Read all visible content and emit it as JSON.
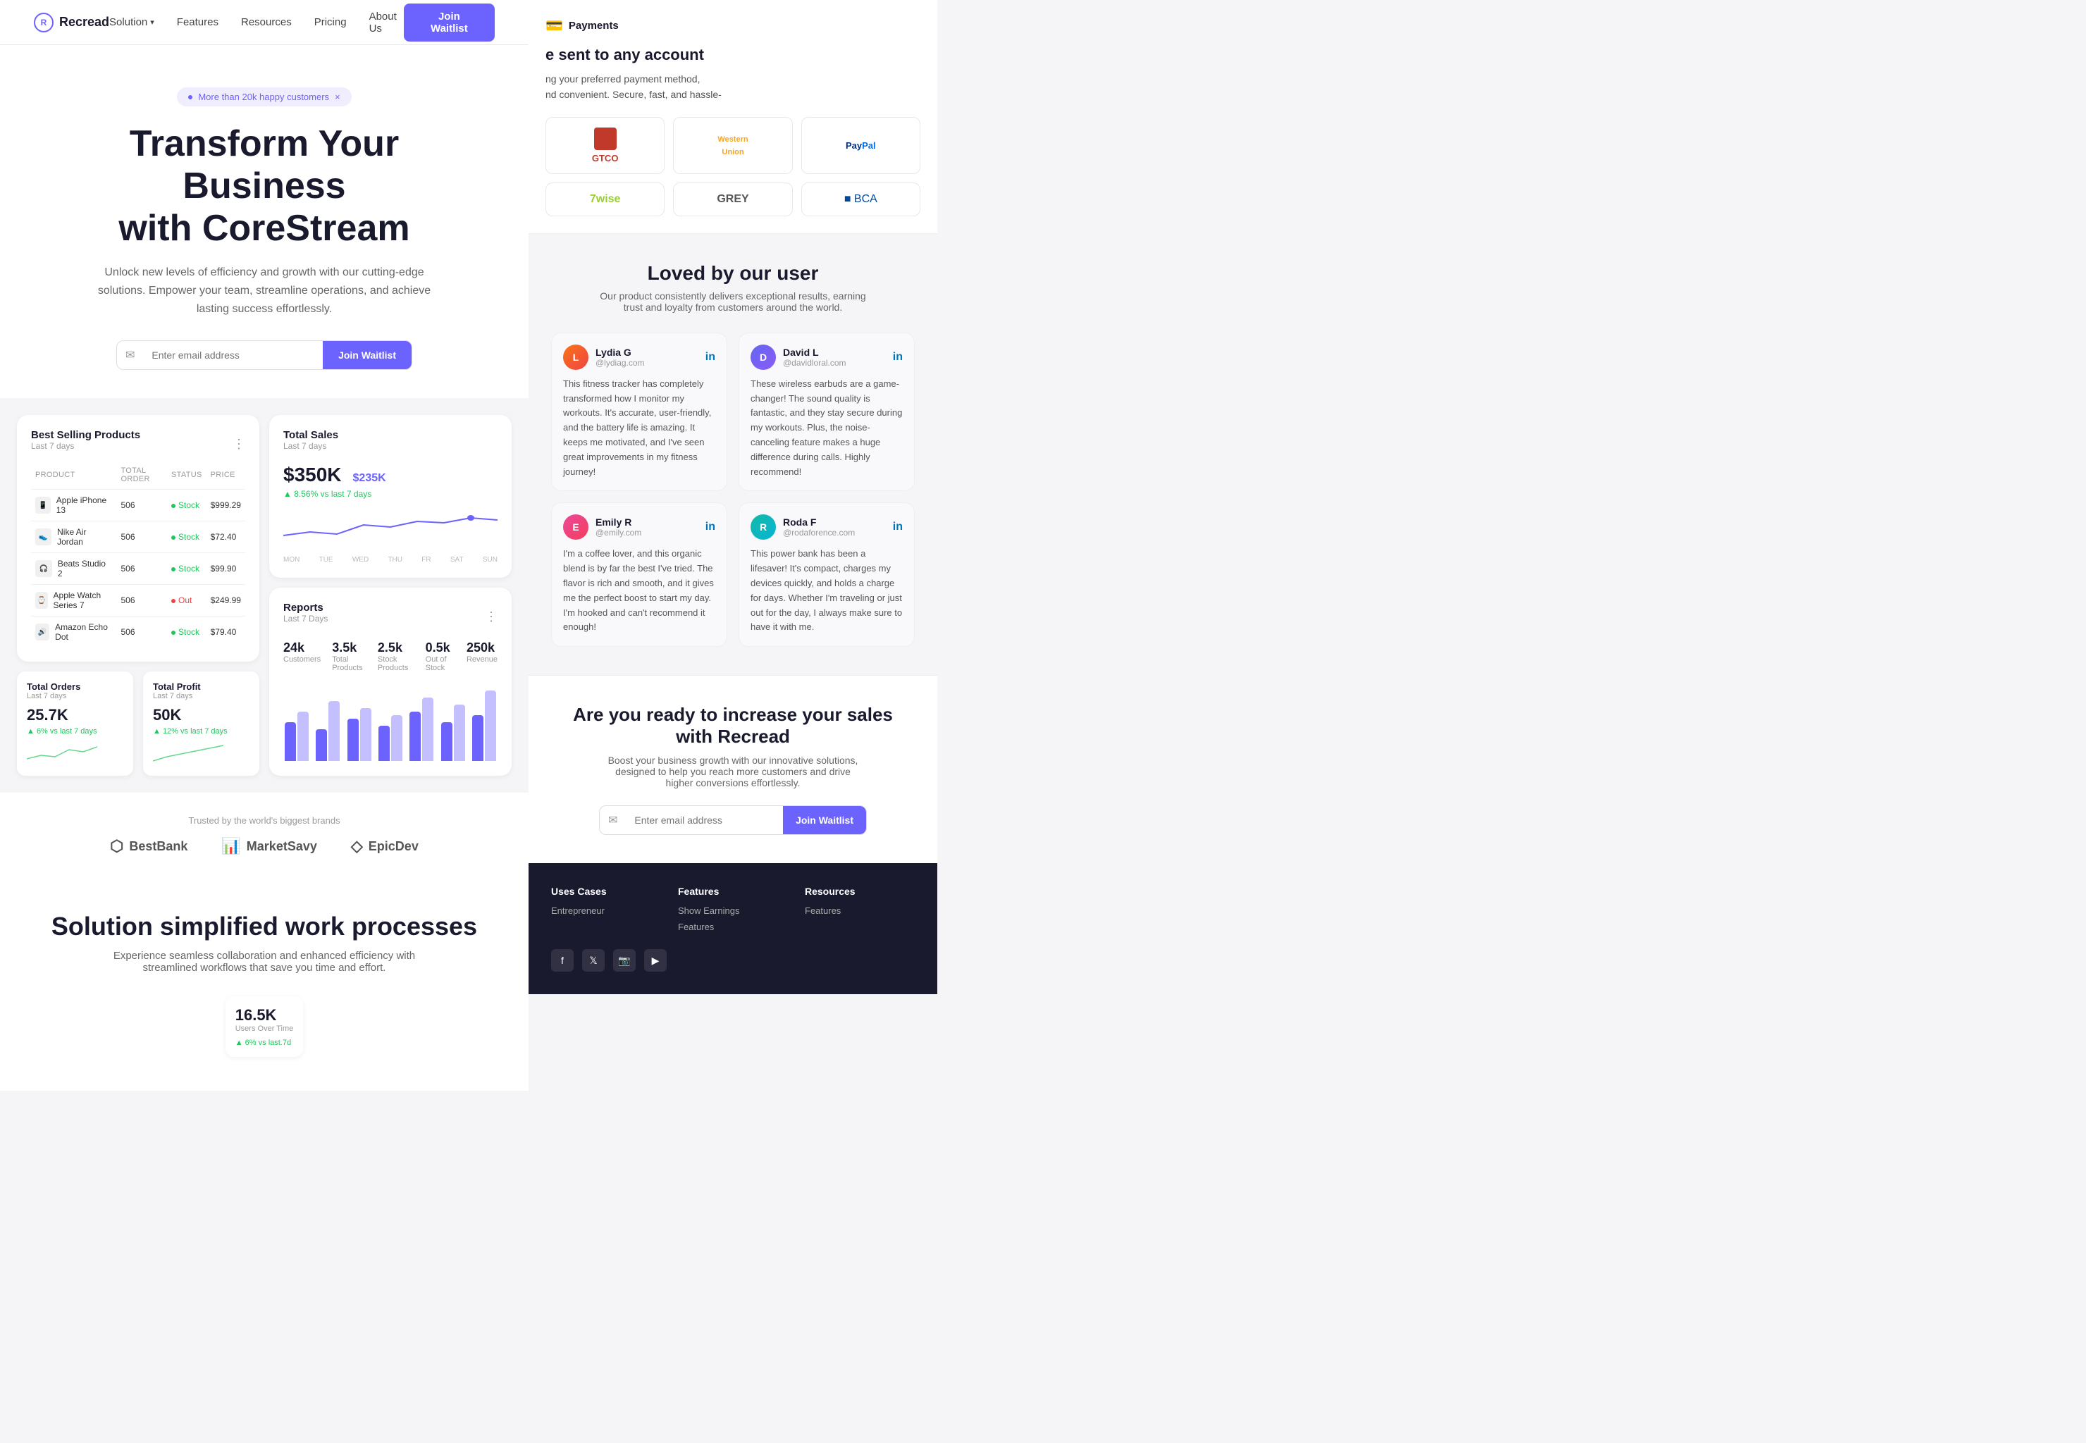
{
  "brand": {
    "name": "Recread",
    "logo_letter": "R"
  },
  "nav": {
    "solution_label": "Solution",
    "features_label": "Features",
    "resources_label": "Resources",
    "pricing_label": "Pricing",
    "about_label": "About Us",
    "cta_label": "Join Waitlist"
  },
  "hero": {
    "badge": "More than 20k happy customers",
    "badge_close": "×",
    "title_line1": "Transform Your Business",
    "title_line2": "with CoreStream",
    "description": "Unlock new levels of efficiency and growth with our cutting-edge solutions. Empower your team, streamline operations, and achieve lasting success effortlessly.",
    "email_placeholder": "Enter email address",
    "cta_label": "Join Waitlist"
  },
  "dashboard": {
    "products": {
      "title": "Best Selling Products",
      "subtitle": "Last 7 days",
      "columns": [
        "PRODUCT",
        "TOTAL ORDER",
        "STATUS",
        "PRICE"
      ],
      "rows": [
        {
          "name": "Apple iPhone 13",
          "orders": "506",
          "status": "Stock",
          "price": "$999.29",
          "in_stock": true
        },
        {
          "name": "Nike Air Jordan",
          "orders": "506",
          "status": "Stock",
          "price": "$72.40",
          "in_stock": true
        },
        {
          "name": "Beats Studio 2",
          "orders": "506",
          "status": "Stock",
          "price": "$99.90",
          "in_stock": true
        },
        {
          "name": "Apple Watch Series 7",
          "orders": "506",
          "status": "Out",
          "price": "$249.99",
          "in_stock": false
        },
        {
          "name": "Amazon Echo Dot",
          "orders": "506",
          "status": "Stock",
          "price": "$79.40",
          "in_stock": true
        }
      ]
    },
    "total_sales": {
      "title": "Total Sales",
      "subtitle": "Last 7 days",
      "amount": "$350K",
      "prev_amount": "$235K",
      "growth": "▲ 8.56%  vs last 7 days",
      "days": [
        "MON",
        "TUE",
        "WED",
        "THU",
        "FR",
        "SAT",
        "SUN"
      ]
    },
    "reports": {
      "title": "Reports",
      "subtitle": "Last 7 Days",
      "stats": [
        {
          "value": "24k",
          "label": "Customers"
        },
        {
          "value": "3.5k",
          "label": "Total Products"
        },
        {
          "value": "2.5k",
          "label": "Stock Products"
        },
        {
          "value": "0.5k",
          "label": "Out of Stock"
        },
        {
          "value": "250k",
          "label": "Revenue"
        }
      ],
      "bars": [
        {
          "dark": 55,
          "light": 70
        },
        {
          "dark": 45,
          "light": 85
        },
        {
          "dark": 60,
          "light": 75
        },
        {
          "dark": 50,
          "light": 65
        },
        {
          "dark": 70,
          "light": 90
        },
        {
          "dark": 55,
          "light": 80
        },
        {
          "dark": 65,
          "light": 100
        }
      ]
    },
    "total_orders": {
      "title": "Total Orders",
      "subtitle": "Last 7 days",
      "value": "25.7K",
      "growth": "▲ 6%  vs last 7 days"
    },
    "total_profit": {
      "title": "Total Profit",
      "subtitle": "Last 7 days",
      "value": "50K",
      "growth": "▲ 12%  vs last 7 days"
    }
  },
  "brands": {
    "label": "Trusted by the world's biggest brands",
    "items": [
      {
        "name": "BestBank",
        "icon": "⬡"
      },
      {
        "name": "MarketSavy",
        "icon": "📊"
      },
      {
        "name": "EpicDev",
        "icon": "◇"
      }
    ]
  },
  "solution": {
    "title": "Solution simplified work processes",
    "description": "Experience seamless collaboration and enhanced efficiency with streamlined workflows that save you time and effort.",
    "stats": [
      {
        "value": "16.5K",
        "label": "Users Over Time"
      }
    ]
  },
  "payments": {
    "header": "Payments",
    "send_title": "e sent to any account",
    "description": "ng your preferred payment method,\nnd convenient. Secure, fast, and hassle-",
    "logos": [
      {
        "name": "GTCO",
        "class": "gtco"
      },
      {
        "name": "Western Union",
        "class": "wu"
      },
      {
        "name": "PayPal",
        "class": "paypal"
      },
      {
        "name": "7Wise",
        "class": "wise"
      },
      {
        "name": "GREY",
        "class": "grey"
      },
      {
        "name": "BCA",
        "class": "bca"
      }
    ]
  },
  "testimonials": {
    "title": "Loved by our user",
    "description": "Our product consistently delivers exceptional results, earning trust and loyalty from customers around the world.",
    "items": [
      {
        "name": "Lydia G",
        "handle": "@lydiag.com",
        "text": "This fitness tracker has completely transformed how I monitor my workouts. It's accurate, user-friendly, and the battery life is amazing. It keeps me motivated, and I've seen great improvements in my fitness journey!",
        "avatar_initials": "L",
        "avatar_class": "avatar-lydia"
      },
      {
        "name": "David L",
        "handle": "@davidloral.com",
        "text": "These wireless earbuds are a game-changer! The sound quality is fantastic, and they stay secure during my workouts. Plus, the noise-canceling feature makes a huge difference during calls. Highly recommend!",
        "avatar_initials": "D",
        "avatar_class": "avatar-david"
      },
      {
        "name": "Emily R",
        "handle": "@emily.com",
        "text": "I'm a coffee lover, and this organic blend is by far the best I've tried. The flavor is rich and smooth, and it gives me the perfect boost to start my day. I'm hooked and can't recommend it enough!",
        "avatar_initials": "E",
        "avatar_class": "avatar-emily"
      },
      {
        "name": "Roda F",
        "handle": "@rodaforence.com",
        "text": "This power bank has been a lifesaver! It's compact, charges my devices quickly, and holds a charge for days. Whether I'm traveling or just out for the day, I always make sure to have it with me.",
        "avatar_initials": "R",
        "avatar_class": "avatar-roda"
      }
    ]
  },
  "cta": {
    "title_line1": "Are you ready to increase your sales",
    "title_line2": "with Recread",
    "description": "Boost your business growth with our innovative solutions, designed to help you reach more customers and drive higher conversions effortlessly.",
    "email_placeholder": "Enter email address",
    "button_label": "Join Waitlist"
  },
  "footer": {
    "columns": [
      {
        "title": "Uses Cases",
        "links": [
          "Entrepreneur"
        ]
      },
      {
        "title": "Features",
        "links": [
          "Show Earnings",
          "Features"
        ]
      },
      {
        "title": "Resources",
        "links": [
          "Features"
        ]
      }
    ],
    "social_icons": [
      "f",
      "𝕏",
      "📷",
      "▶"
    ]
  }
}
